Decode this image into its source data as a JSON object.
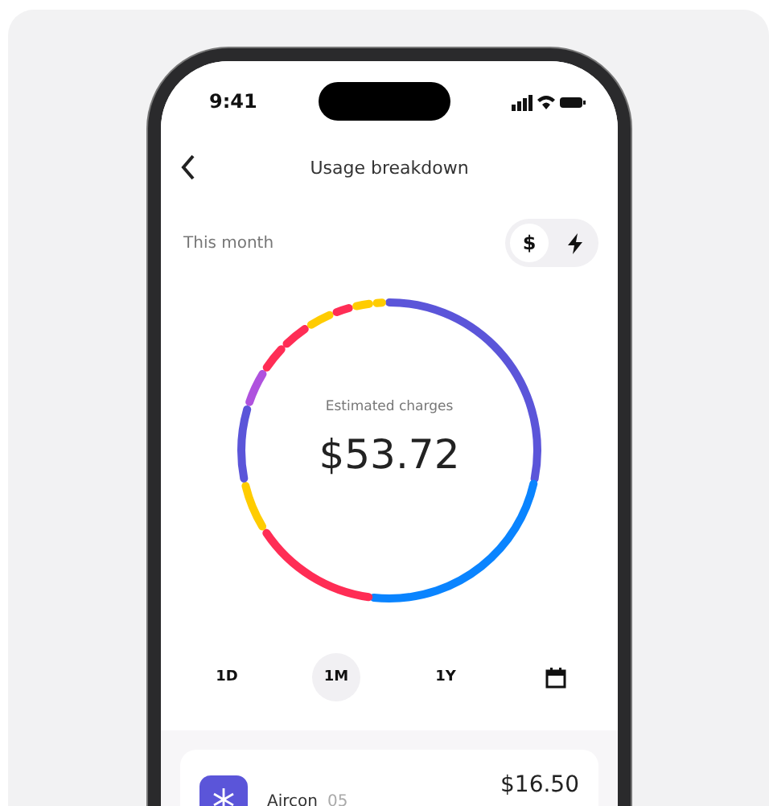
{
  "status_bar": {
    "time": "9:41"
  },
  "header": {
    "title": "Usage breakdown"
  },
  "period_label": "This month",
  "unit_toggle": [
    {
      "kind": "dollar",
      "label": "$",
      "selected": true
    },
    {
      "kind": "bolt",
      "selected": false
    }
  ],
  "summary": {
    "caption": "Estimated charges",
    "amount": "$53.72"
  },
  "ranges": [
    {
      "kind": "text",
      "label": "1D",
      "selected": false
    },
    {
      "kind": "text",
      "label": "1M",
      "selected": true
    },
    {
      "kind": "text",
      "label": "1Y",
      "selected": false
    },
    {
      "kind": "calendar",
      "selected": false
    }
  ],
  "items": [
    {
      "name": "Aircon",
      "count": "05",
      "amount": "$16.50",
      "color": "#5b55d9"
    }
  ]
}
